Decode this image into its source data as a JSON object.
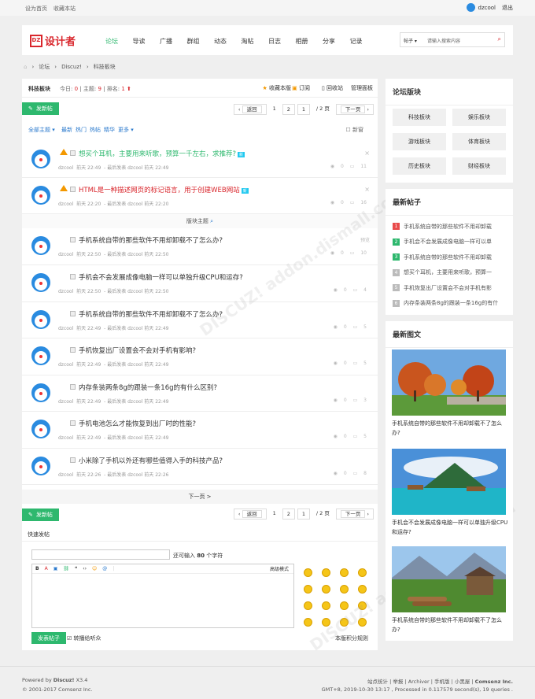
{
  "top": {
    "set_home": "设为首页",
    "bookmark": "收藏本站",
    "user": "dzcool",
    "logout": "退出"
  },
  "logo": {
    "mark": "DZ",
    "text": "设计者"
  },
  "nav": [
    "论坛",
    "导读",
    "广播",
    "群组",
    "动态",
    "淘帖",
    "日志",
    "相册",
    "分享",
    "记录"
  ],
  "search": {
    "type": "帖子",
    "placeholder": "请输入搜索内容"
  },
  "breadcrumb": [
    "论坛",
    "Discuz!",
    "科技板块"
  ],
  "forum": {
    "name": "科技板块",
    "today_label": "今日:",
    "today": "0",
    "topics_label": "主题:",
    "topics": "9",
    "rank_label": "排名:",
    "rank": "1",
    "fav": "收藏本版",
    "rss": "订阅",
    "recycle": "回收站",
    "manage": "管理面板"
  },
  "post_btn": "发新帖",
  "pager": {
    "back": "返回",
    "p1": "1",
    "p2": "2",
    "cur": "1",
    "total": "/ 2 页",
    "next": "下一页"
  },
  "filter": {
    "all": "全部主题",
    "latest": "最新",
    "hot": "热门",
    "hotpost": "热帖",
    "digest": "精华",
    "more": "更多",
    "newwin": "新窗"
  },
  "sticky": [
    {
      "title": "想买个耳机，主要用来听歌，预算一千左右，求推荐?",
      "badge": "新",
      "author": "dzcool",
      "time": "前天 22:49",
      "last_label": "最后发表",
      "last": "dzcool 前天 22:49",
      "views": "0",
      "replies": "11"
    },
    {
      "title": "HTML是一种描述网页的标记语言，用于创建WEB网站",
      "badge": "新",
      "author": "dzcool",
      "time": "前天 22:20",
      "last_label": "最后发表",
      "last": "dzcool 前天 22:20",
      "views": "0",
      "replies": "16"
    }
  ],
  "section_label": "版块主题",
  "threads": [
    {
      "title": "手机系统自带的那些软件不用却卸载不了怎么办?",
      "author": "dzcool",
      "time": "前天 22:50",
      "last_label": "最后发表",
      "last": "dzcool 前天 22:50",
      "views": "0",
      "replies": "10",
      "tag": "预览"
    },
    {
      "title": "手机会不会发展成像电脑一样可以单独升级CPU和运存?",
      "author": "dzcool",
      "time": "前天 22:50",
      "last_label": "最后发表",
      "last": "dzcool 前天 22:50",
      "views": "0",
      "replies": "4"
    },
    {
      "title": "手机系统自带的那些软件不用却卸载不了怎么办?",
      "author": "dzcool",
      "time": "前天 22:49",
      "last_label": "最后发表",
      "last": "dzcool 前天 22:49",
      "views": "0",
      "replies": "5"
    },
    {
      "title": "手机恢复出厂设置会不会对手机有影响?",
      "author": "dzcool",
      "time": "前天 22:49",
      "last_label": "最后发表",
      "last": "dzcool 前天 22:49",
      "views": "0",
      "replies": "5"
    },
    {
      "title": "内存条装两条8g的跟装一条16g的有什么区别?",
      "author": "dzcool",
      "time": "前天 22:49",
      "last_label": "最后发表",
      "last": "dzcool 前天 22:49",
      "views": "0",
      "replies": "3"
    },
    {
      "title": "手机电池怎么才能恢复到出厂时的性能?",
      "author": "dzcool",
      "time": "前天 22:49",
      "last_label": "最后发表",
      "last": "dzcool 前天 22:49",
      "views": "0",
      "replies": "5"
    },
    {
      "title": "小米除了手机以外还有哪些值得入手的科技产品?",
      "author": "dzcool",
      "time": "前天 22:26",
      "last_label": "最后发表",
      "last": "dzcool 前天 22:26",
      "views": "0",
      "replies": "8"
    }
  ],
  "nextpage": "下一页 >",
  "quick": {
    "title": "快速发帖",
    "remain": "还可输入",
    "remain_num": "80",
    "remain_unit": "个字符",
    "advanced": "高级模式",
    "submit": "发表帖子",
    "sync": "转播给听众",
    "rules": "本版积分规则"
  },
  "sidebar": {
    "forums_title": "论坛版块",
    "forums": [
      "科技板块",
      "娱乐板块",
      "游戏板块",
      "体育板块",
      "历史板块",
      "财经板块"
    ],
    "latest_title": "最新帖子",
    "latest": [
      "手机系统自带的那些软件不用却卸载",
      "手机会不会发展成像电脑一样可以单",
      "手机系统自带的那些软件不用却卸载",
      "想买个耳机，主要用来听歌，预算一",
      "手机恢复出厂设置会不会对手机有影",
      "内存条装两条8g的跟装一条16g的有什"
    ],
    "pics_title": "最新图文",
    "pics": [
      "手机系统自带的那些软件不用却卸载不了怎么办?",
      "手机会不会发展成像电脑一样可以单独升级CPU和运存?",
      "手机系统自带的那些软件不用却卸载不了怎么办?"
    ]
  },
  "footer": {
    "powered": "Powered by",
    "product": "Discuz!",
    "ver": "X3.4",
    "copy": "© 2001-2017 Comsenz Inc.",
    "links": "站点统计 | 举报 | Archiver | 手机版 | 小黑屋 |",
    "company": "Comsenz Inc.",
    "gmt": "GMT+8, 2019-10-30 13:17 , Processed in 0.117579 second(s), 19 queries ."
  }
}
